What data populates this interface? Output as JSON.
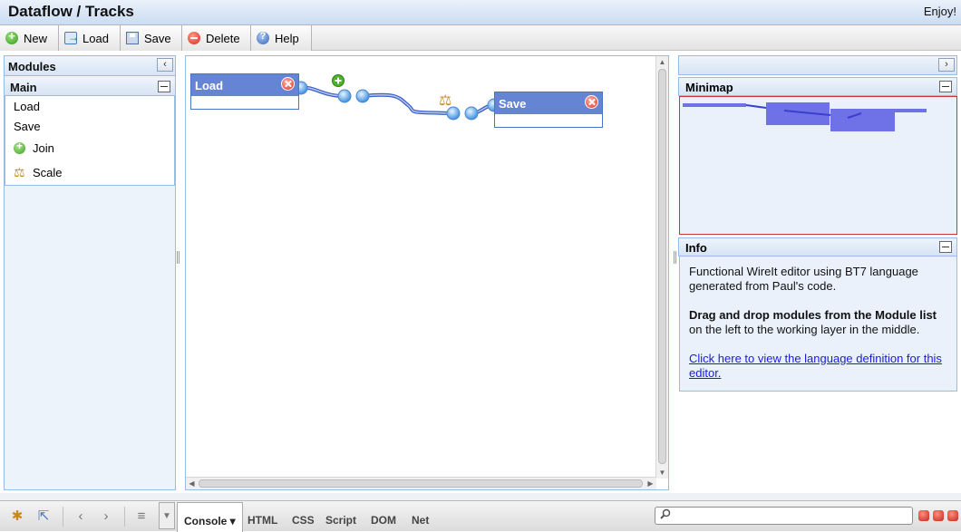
{
  "header": {
    "title": "Dataflow / Tracks",
    "right_text": "Enjoy!"
  },
  "toolbar": {
    "new_label": "New",
    "load_label": "Load",
    "save_label": "Save",
    "delete_label": "Delete",
    "help_label": "Help"
  },
  "left_panel": {
    "title": "Modules",
    "collapse_icon": "chevron-left-icon",
    "group": {
      "title": "Main",
      "items": [
        {
          "label": "Load"
        },
        {
          "label": "Save"
        },
        {
          "label": "Join",
          "icon": "add-circle-icon"
        },
        {
          "label": "Scale",
          "icon": "scale-icon"
        }
      ]
    }
  },
  "canvas": {
    "modules": [
      {
        "title": "Load"
      },
      {
        "title": "Save"
      }
    ]
  },
  "right_panel": {
    "expand_icon": "chevron-right-icon",
    "minimap": {
      "title": "Minimap"
    },
    "info": {
      "title": "Info",
      "paragraph1": "Functional WireIt editor using BT7 language generated from Paul's code.",
      "paragraph2_bold": "Drag and drop modules from the Module list",
      "paragraph2_rest": " on the left to the working layer in the middle.",
      "link_text": "Click here to view the language definition for this editor."
    }
  },
  "devtools": {
    "tabs": [
      "Console",
      "HTML",
      "CSS",
      "Script",
      "DOM",
      "Net"
    ],
    "active_tab": "Console",
    "search_placeholder": ""
  },
  "colors": {
    "module_header": "#6584d4",
    "panel_border": "#99bbe8",
    "wire": "#3a5fc7",
    "link": "#1a1ae0"
  }
}
